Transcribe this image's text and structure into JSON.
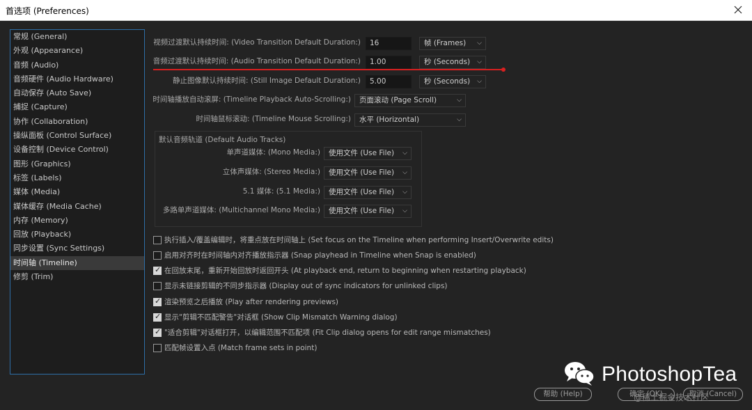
{
  "window": {
    "title": "首选项 (Preferences)"
  },
  "sidebar": {
    "items": [
      {
        "label": "常规 (General)"
      },
      {
        "label": "外观 (Appearance)"
      },
      {
        "label": "音频 (Audio)"
      },
      {
        "label": "音频硬件 (Audio Hardware)"
      },
      {
        "label": "自动保存 (Auto Save)"
      },
      {
        "label": "捕捉 (Capture)"
      },
      {
        "label": "协作 (Collaboration)"
      },
      {
        "label": "操纵面板 (Control Surface)"
      },
      {
        "label": "设备控制 (Device Control)"
      },
      {
        "label": "图形 (Graphics)"
      },
      {
        "label": "标签 (Labels)"
      },
      {
        "label": "媒体 (Media)"
      },
      {
        "label": "媒体缓存 (Media Cache)"
      },
      {
        "label": "内存 (Memory)"
      },
      {
        "label": "回放 (Playback)"
      },
      {
        "label": "同步设置 (Sync Settings)"
      },
      {
        "label": "时间轴 (Timeline)"
      },
      {
        "label": "修剪 (Trim)"
      }
    ],
    "selected": "时间轴 (Timeline)"
  },
  "settings": {
    "video_transition": {
      "label": "视频过渡默认持续时间: (Video Transition Default Duration:)",
      "value": "16",
      "unit": "帧 (Frames)"
    },
    "audio_transition": {
      "label": "音频过渡默认持续时间: (Audio Transition Default Duration:)",
      "value": "1.00",
      "unit": "秒 (Seconds)"
    },
    "still_image": {
      "label": "静止图像默认持续时间: (Still Image Default Duration:)",
      "value": "5.00",
      "unit": "秒 (Seconds)"
    },
    "auto_scrolling": {
      "label": "时间轴播放自动滚屏: (Timeline Playback Auto-Scrolling:)",
      "value": "页面滚动 (Page Scroll)"
    },
    "mouse_scrolling": {
      "label": "时间轴鼠标滚动: (Timeline Mouse Scrolling:)",
      "value": "水平 (Horizontal)"
    }
  },
  "audio_tracks": {
    "title": "默认音频轨道 (Default Audio Tracks)",
    "rows": [
      {
        "label": "单声道媒体: (Mono Media:)",
        "value": "使用文件 (Use File)"
      },
      {
        "label": "立体声媒体: (Stereo Media:)",
        "value": "使用文件 (Use File)"
      },
      {
        "label": "5.1 媒体: (5.1 Media:)",
        "value": "使用文件 (Use File)"
      },
      {
        "label": "多路单声道媒体: (Multichannel Mono Media:)",
        "value": "使用文件 (Use File)"
      }
    ]
  },
  "checkboxes": [
    {
      "label": "执行插入/覆盖编辑时，将重点放在时间轴上 (Set focus on the Timeline when performing Insert/Overwrite edits)",
      "checked": false
    },
    {
      "label": "启用对齐时在时间轴内对齐播放指示器 (Snap playhead in Timeline when Snap is enabled)",
      "checked": false
    },
    {
      "label": "在回放末尾，重新开始回放时返回开头 (At playback end, return to beginning when restarting playback)",
      "checked": true
    },
    {
      "label": "显示未链接剪辑的不同步指示器 (Display out of sync indicators for unlinked clips)",
      "checked": false
    },
    {
      "label": "渲染预览之后播放 (Play after rendering previews)",
      "checked": true
    },
    {
      "label": "显示\"剪辑不匹配警告\"对话框 (Show Clip Mismatch Warning dialog)",
      "checked": true
    },
    {
      "label": "\"适合剪辑\"对话框打开，以编辑范围不匹配项 (Fit Clip dialog opens for edit range mismatches)",
      "checked": true
    },
    {
      "label": "匹配帧设置入点 (Match frame sets in point)",
      "checked": false
    }
  ],
  "buttons": {
    "help": "帮助 (Help)",
    "ok": "确定 (OK)",
    "cancel": "取消 (Cancel)"
  },
  "watermark": {
    "brand": "PhotoshopTea",
    "sub": "@稀土掘金技术社区"
  },
  "colors": {
    "accent_line": "#d92020",
    "sidebar_border": "#2e6fa8"
  }
}
